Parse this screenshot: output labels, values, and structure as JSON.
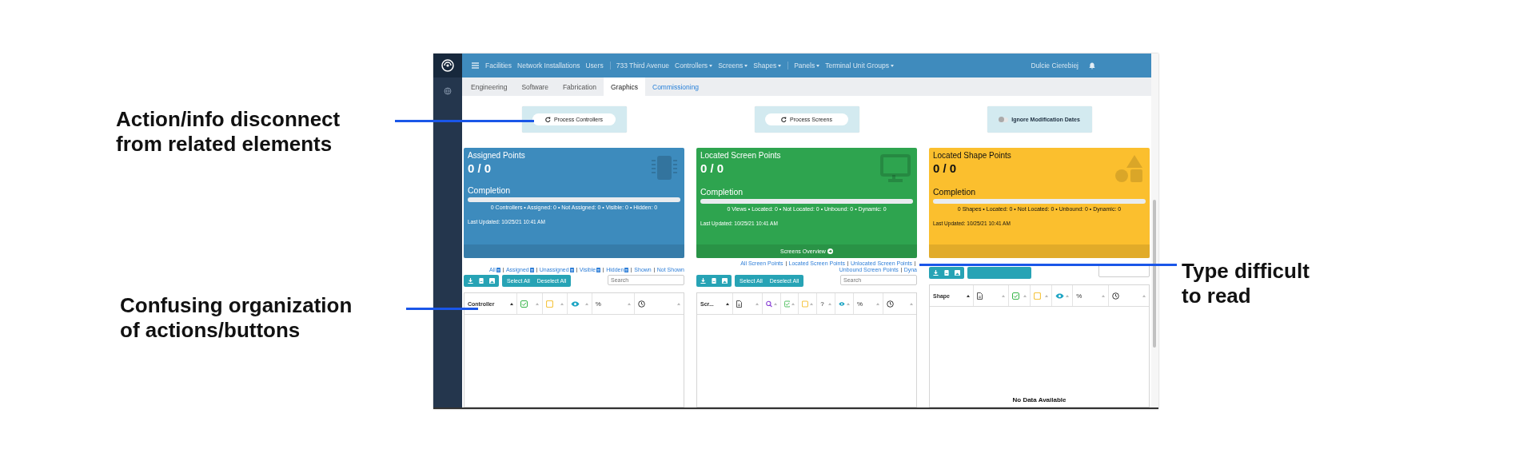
{
  "annotations": {
    "left": [
      {
        "text": "Action/info disconnect\nfrom related elements"
      },
      {
        "text": "Confusing organization\nof actions/buttons"
      }
    ],
    "right": [
      {
        "text": "Type difficult\nto read"
      }
    ]
  },
  "nav": {
    "items": [
      {
        "label": "Facilities",
        "dropdown": false,
        "group_end": false
      },
      {
        "label": "Network Installations",
        "dropdown": false,
        "group_end": false
      },
      {
        "label": "Users",
        "dropdown": false,
        "group_end": true
      },
      {
        "label": "733 Third Avenue",
        "dropdown": false,
        "group_end": false
      },
      {
        "label": "Controllers",
        "dropdown": true,
        "group_end": false
      },
      {
        "label": "Screens",
        "dropdown": true,
        "group_end": false
      },
      {
        "label": "Shapes",
        "dropdown": true,
        "group_end": true
      },
      {
        "label": "Panels",
        "dropdown": true,
        "group_end": false
      },
      {
        "label": "Terminal Unit Groups",
        "dropdown": true,
        "group_end": false
      }
    ],
    "user": "Dulcie Cierebiej"
  },
  "tabs": [
    {
      "label": "Engineering",
      "selected": false,
      "accent": false
    },
    {
      "label": "Software",
      "selected": false,
      "accent": false
    },
    {
      "label": "Fabrication",
      "selected": false,
      "accent": false
    },
    {
      "label": "Graphics",
      "selected": true,
      "accent": false
    },
    {
      "label": "Commissioning",
      "selected": false,
      "accent": true
    }
  ],
  "actions": [
    {
      "kind": "button",
      "label": "Process Controllers"
    },
    {
      "kind": "button",
      "label": "Process Screens"
    },
    {
      "kind": "toggle",
      "label": "Ignore Modification Dates",
      "on": false
    }
  ],
  "cards": [
    {
      "kind": "controllers",
      "color": "#3d8bbd",
      "title": "Assigned Points",
      "value": "0 / 0",
      "completion": "Completion",
      "level": 0,
      "stats": "0 Controllers • Assigned: 0 • Not Assigned: 0 • Visible: 0 • Hidden: 0",
      "updated": "Last Updated: 10/25/21 10:41 AM"
    },
    {
      "kind": "screens",
      "color": "#2ea44f",
      "title": "Located Screen Points",
      "value": "0 / 0",
      "completion": "Completion",
      "level": 0,
      "stats": "0 Views • Located: 0 • Not Located: 0 • Unbound: 0 • Dynamic: 0",
      "updated": "Last Updated: 10/25/21 10:41 AM",
      "footer": "Screens Overview"
    },
    {
      "kind": "shapes",
      "color": "#fbbf2e",
      "title": "Located Shape Points",
      "value": "0 / 0",
      "completion": "Completion",
      "level": 0,
      "stats": "0 Shapes • Located: 0 • Not Located: 0 • Unbound: 0 • Dynamic: 0",
      "updated": "Last Updated: 10/25/21 10:41 AM"
    }
  ],
  "tables": [
    {
      "links": [
        {
          "label": "All",
          "icon": true
        },
        {
          "label": "Assigned",
          "icon": true
        },
        {
          "label": "Unassigned",
          "icon": true
        },
        {
          "label": "Visible",
          "icon": true
        },
        {
          "label": "Hidden",
          "icon": true
        },
        {
          "label": "Shown",
          "icon": false
        },
        {
          "label": "Not Shown",
          "icon": false
        }
      ],
      "toolbar_obscured": false,
      "buttons": [
        "Select All",
        "Deselect All"
      ],
      "search_placeholder": "Search",
      "columns": [
        {
          "kind": "name",
          "label": "Controller"
        },
        {
          "kind": "check"
        },
        {
          "kind": "note"
        },
        {
          "kind": "eye"
        },
        {
          "kind": "percent",
          "label": "%"
        },
        {
          "kind": "clock"
        }
      ]
    },
    {
      "links": [
        {
          "label": "All Screen Points",
          "icon": false
        },
        {
          "label": "Located Screen Points",
          "icon": false
        },
        {
          "label": "Unlocated Screen Points",
          "icon": false
        },
        {
          "label": "Unbound Screen Points",
          "icon": false
        },
        {
          "label": "Dyna",
          "icon": false
        }
      ],
      "toolbar_obscured": false,
      "buttons": [
        "Select All",
        "Deselect All"
      ],
      "search_placeholder": "Search",
      "columns": [
        {
          "kind": "name",
          "label": "Scr..."
        },
        {
          "kind": "doc"
        },
        {
          "kind": "search"
        },
        {
          "kind": "check"
        },
        {
          "kind": "note"
        },
        {
          "kind": "question",
          "label": "?"
        },
        {
          "kind": "eye"
        },
        {
          "kind": "percent",
          "label": "%"
        },
        {
          "kind": "clock"
        }
      ]
    },
    {
      "toolbar_obscured": true,
      "columns": [
        {
          "kind": "name",
          "label": "Shape"
        },
        {
          "kind": "doc"
        },
        {
          "kind": "check"
        },
        {
          "kind": "note"
        },
        {
          "kind": "eye"
        },
        {
          "kind": "percent",
          "label": "%"
        },
        {
          "kind": "clock"
        }
      ],
      "empty_text": "No Data Available"
    }
  ]
}
